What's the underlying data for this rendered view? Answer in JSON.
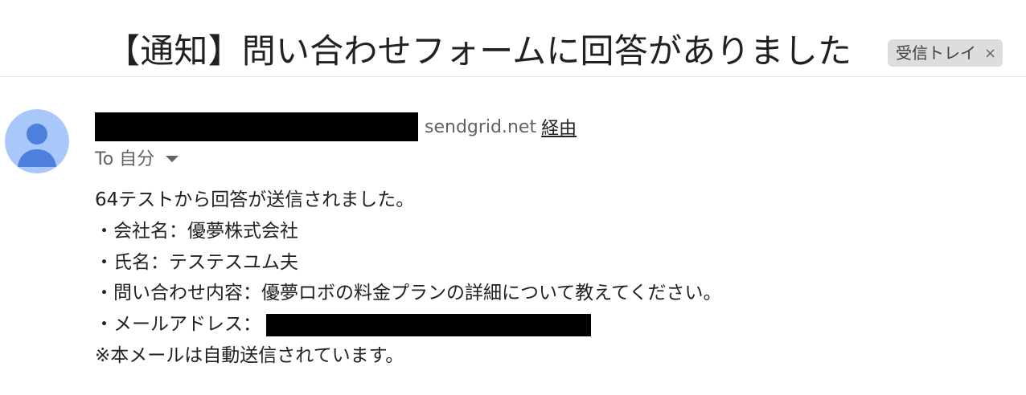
{
  "header": {
    "subject": "【通知】問い合わせフォームに回答がありました",
    "label": "受信トレイ",
    "label_close": "×"
  },
  "sender": {
    "domain": "sendgrid.net",
    "via": "経由",
    "avatar_icon": "person-icon",
    "avatar_bg": "#a8c7fa",
    "avatar_fg": "#4f7fdc"
  },
  "recipient": {
    "text": "To 自分"
  },
  "message": {
    "lines": [
      "64テストから回答が送信されました。",
      "・会社名：優夢株式会社",
      "・氏名：テステスユム夫",
      "・問い合わせ内容：優夢ロボの料金プランの詳細について教えてください。",
      "・メールアドレス：",
      "※本メールは自動送信されています。"
    ]
  }
}
